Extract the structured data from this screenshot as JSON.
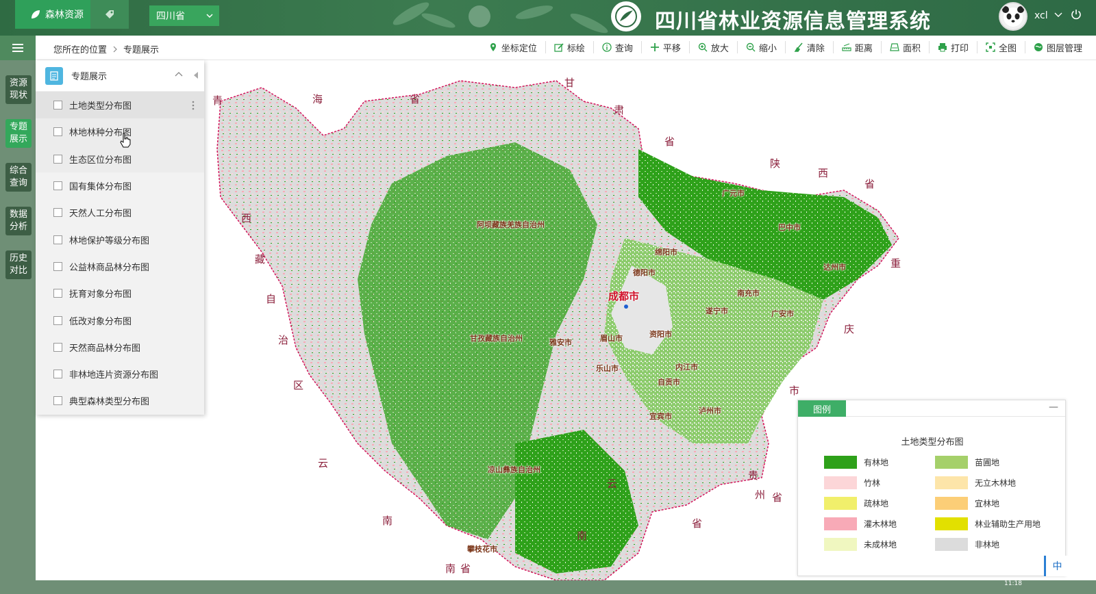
{
  "header": {
    "brand_tab": "森林资源",
    "province": "四川省",
    "app_title": "四川省林业资源信息管理系统",
    "username": "xcl"
  },
  "breadcrumb": {
    "prefix": "您所在的位置",
    "current": "专题展示"
  },
  "toolbar": [
    {
      "label": "坐标定位",
      "icon": "location-pin-icon"
    },
    {
      "label": "标绘",
      "icon": "draw-icon"
    },
    {
      "label": "查询",
      "icon": "info-icon"
    },
    {
      "label": "平移",
      "icon": "pan-icon"
    },
    {
      "label": "放大",
      "icon": "zoom-in-icon"
    },
    {
      "label": "缩小",
      "icon": "zoom-out-icon"
    },
    {
      "label": "清除",
      "icon": "clear-icon"
    },
    {
      "label": "距离",
      "icon": "ruler-icon"
    },
    {
      "label": "面积",
      "icon": "area-icon"
    },
    {
      "label": "打印",
      "icon": "print-icon"
    },
    {
      "label": "全图",
      "icon": "full-extent-icon"
    },
    {
      "label": "图层管理",
      "icon": "layers-icon"
    }
  ],
  "leftnav": [
    {
      "label": "资源现状",
      "active": false
    },
    {
      "label": "专题展示",
      "active": true
    },
    {
      "label": "综合查询",
      "active": false
    },
    {
      "label": "数据分析",
      "active": false
    },
    {
      "label": "历史对比",
      "active": false
    }
  ],
  "theme_panel": {
    "title": "专题展示",
    "layers": [
      "土地类型分布图",
      "林地林种分布图",
      "生态区位分布图",
      "国有集体分布图",
      "天然人工分布图",
      "林地保护等级分布图",
      "公益林商品林分布图",
      "抚育对象分布图",
      "低改对象分布图",
      "天然商品林分布图",
      "非林地连片资源分布图",
      "典型森林类型分布图"
    ]
  },
  "map": {
    "neighbors": [
      "青",
      "海",
      "省",
      "甘",
      "肃",
      "省",
      "陕",
      "西",
      "省",
      "西",
      "藏",
      "自",
      "治",
      "区",
      "重",
      "庆",
      "市",
      "云",
      "南",
      "云",
      "南",
      "省",
      "贵",
      "州",
      "省",
      "南",
      "省"
    ],
    "capital": "成都市",
    "cities": [
      "广元市",
      "巴中市",
      "绵阳市",
      "德阳市",
      "达州市",
      "南充市",
      "遂宁市",
      "广安市",
      "资阳市",
      "眉山市",
      "雅安市",
      "乐山市",
      "内江市",
      "自贡市",
      "宜宾市",
      "泸州市",
      "攀枝花市"
    ],
    "regions": [
      "阿坝藏族羌族自治州",
      "甘孜藏族自治州",
      "凉山彝族自治州"
    ]
  },
  "legend": {
    "tab": "图例",
    "title": "土地类型分布图",
    "items": [
      {
        "label": "有林地",
        "color": "#2ea11a"
      },
      {
        "label": "苗圃地",
        "color": "#a5d06a"
      },
      {
        "label": "竹林",
        "color": "#fcd6d8"
      },
      {
        "label": "无立木林地",
        "color": "#fde5a9"
      },
      {
        "label": "疏林地",
        "color": "#f1ef6b"
      },
      {
        "label": "宜林地",
        "color": "#fcce77"
      },
      {
        "label": "灌木林地",
        "color": "#f8aab7"
      },
      {
        "label": "林业辅助生产用地",
        "color": "#e2e000"
      },
      {
        "label": "未成林地",
        "color": "#f0f7c0"
      },
      {
        "label": "非林地",
        "color": "#dcdcdc"
      }
    ]
  },
  "ime": "中",
  "time": "11:18"
}
